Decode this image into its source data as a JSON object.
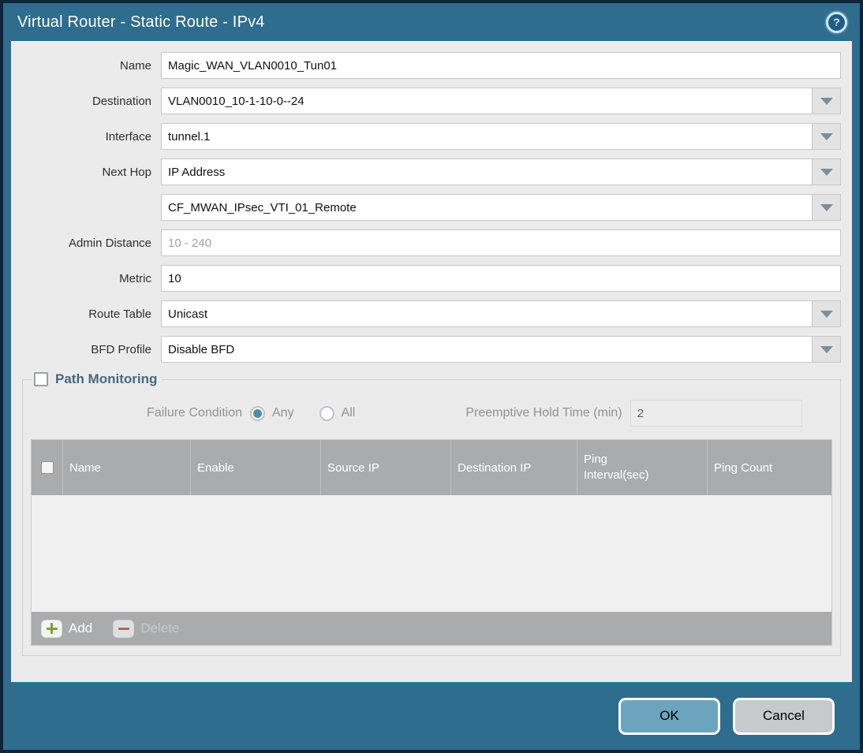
{
  "dialog": {
    "title": "Virtual Router - Static Route - IPv4"
  },
  "icons": {
    "help": "?"
  },
  "form": {
    "name": {
      "label": "Name",
      "value": "Magic_WAN_VLAN0010_Tun01"
    },
    "destination": {
      "label": "Destination",
      "value": "VLAN0010_10-1-10-0--24"
    },
    "interface": {
      "label": "Interface",
      "value": "tunnel.1"
    },
    "next_hop": {
      "label": "Next Hop",
      "value": "IP Address"
    },
    "next_hop_address": {
      "value": "CF_MWAN_IPsec_VTI_01_Remote"
    },
    "admin_distance": {
      "label": "Admin Distance",
      "placeholder": "10 - 240"
    },
    "metric": {
      "label": "Metric",
      "value": "10"
    },
    "route_table": {
      "label": "Route Table",
      "value": "Unicast"
    },
    "bfd_profile": {
      "label": "BFD Profile",
      "value": "Disable BFD"
    }
  },
  "path_monitoring": {
    "title": "Path Monitoring",
    "checkbox_checked": false,
    "failure_condition": {
      "label": "Failure Condition",
      "options": [
        "Any",
        "All"
      ],
      "selected": "Any"
    },
    "preemptive_hold": {
      "label": "Preemptive Hold Time (min)",
      "value": "2"
    },
    "table": {
      "columns": [
        "Name",
        "Enable",
        "Source IP",
        "Destination IP",
        "Ping Interval(sec)",
        "Ping Count"
      ],
      "rows": []
    },
    "actions": {
      "add": "Add",
      "delete": "Delete",
      "delete_enabled": false
    }
  },
  "footer": {
    "ok": "OK",
    "cancel": "Cancel"
  },
  "colors": {
    "titlebar_bg": "#2e6d8e",
    "frame_border": "#0f2435",
    "content_bg": "#ebebeb",
    "table_header_bg": "#a9abad",
    "ok_button_bg": "#6ca4bf",
    "cancel_button_bg": "#c8c9cb",
    "radio_selected": "#4e8ca8",
    "add_icon_green": "#7f9e3a",
    "delete_icon_red": "#a8695c"
  }
}
